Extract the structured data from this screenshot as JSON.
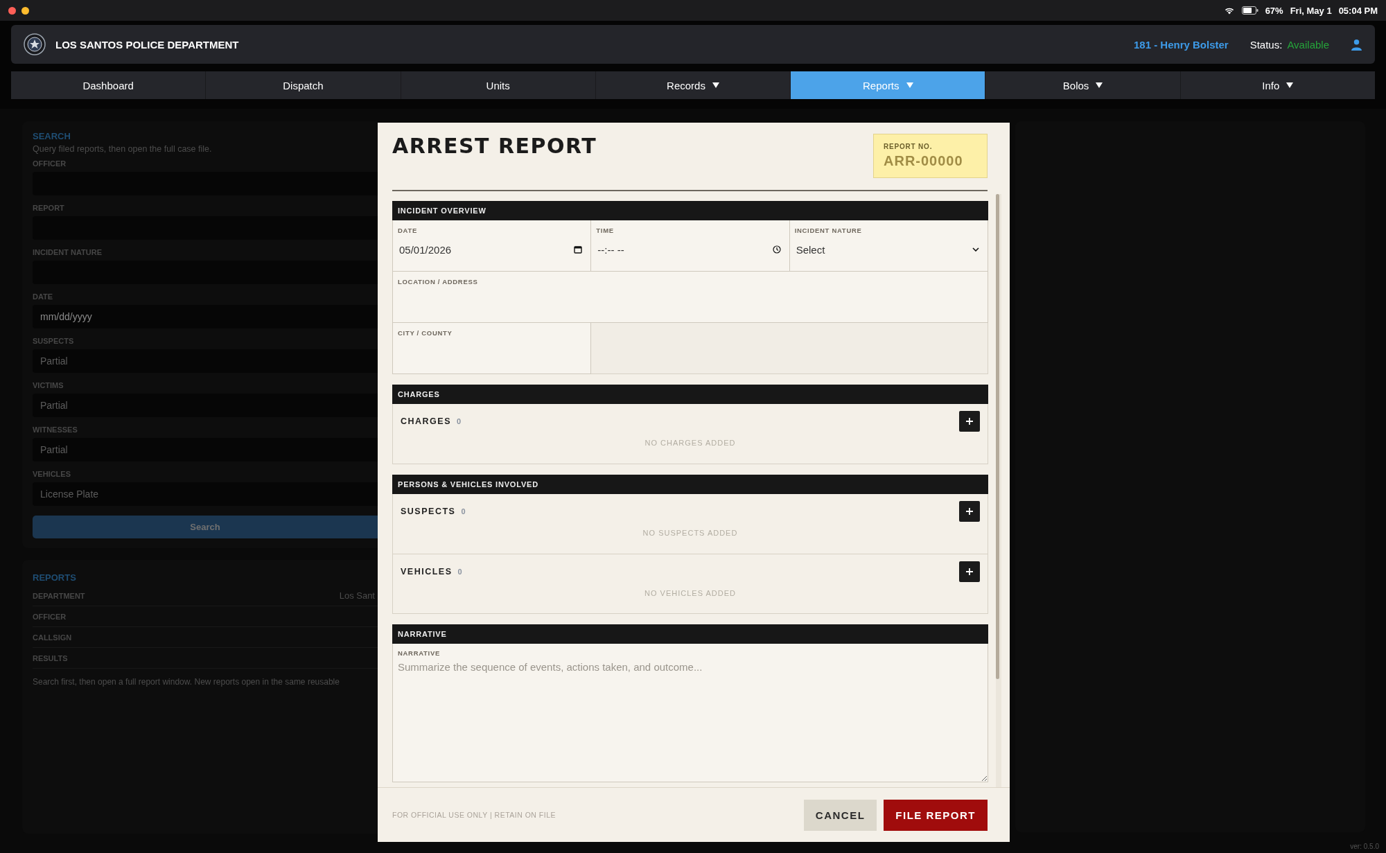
{
  "system_bar": {
    "battery": "67%",
    "date": "Fri, May 1",
    "time": "05:04 PM"
  },
  "header": {
    "title": "LOS SANTOS POLICE DEPARTMENT",
    "user": "181 - Henry Bolster",
    "status_label": "Status:",
    "status": "Available"
  },
  "tabs": [
    {
      "label": "Dashboard",
      "selected": false,
      "dropdown": false
    },
    {
      "label": "Dispatch",
      "selected": false,
      "dropdown": false
    },
    {
      "label": "Units",
      "selected": false,
      "dropdown": false
    },
    {
      "label": "Records",
      "selected": false,
      "dropdown": true
    },
    {
      "label": "Reports",
      "selected": true,
      "dropdown": true
    },
    {
      "label": "Bolos",
      "selected": false,
      "dropdown": true
    },
    {
      "label": "Info",
      "selected": false,
      "dropdown": true
    }
  ],
  "search_panel": {
    "title": "SEARCH",
    "description": "Query filed reports, then open the full case file.",
    "fields": [
      {
        "label": "OFFICER"
      },
      {
        "label": "REPORT"
      },
      {
        "label": "INCIDENT NATURE"
      },
      {
        "label": "DATE",
        "value": "mm/dd/yyyy"
      },
      {
        "label": "SUSPECTS",
        "placeholder": "Partial"
      },
      {
        "label": "VICTIMS",
        "placeholder": "Partial"
      },
      {
        "label": "WITNESSES",
        "placeholder": "Partial"
      },
      {
        "label": "VEHICLES",
        "placeholder": "License Plate"
      }
    ],
    "button": "Search"
  },
  "reports_panel": {
    "title": "REPORTS",
    "rows": [
      {
        "label": "DEPARTMENT",
        "value": "Los Sant"
      },
      {
        "label": "OFFICER"
      },
      {
        "label": "CALLSIGN"
      },
      {
        "label": "RESULTS"
      }
    ],
    "note": "Search first, then open a full report window. New reports open in the same reusable"
  },
  "modal": {
    "title": "ARREST REPORT",
    "report_no_label": "REPORT NO.",
    "report_no": "ARR-00000",
    "sections": [
      {
        "kind": "fields",
        "title": "INCIDENT OVERVIEW",
        "fields": [
          {
            "kind": "date",
            "label": "DATE",
            "value": "05/01/2026"
          },
          {
            "kind": "time",
            "label": "TIME",
            "value": "--:-- --"
          },
          {
            "kind": "select",
            "label": "INCIDENT NATURE",
            "value": "Select"
          },
          {
            "kind": "text",
            "label": "LOCATION / ADDRESS"
          },
          {
            "kind": "text",
            "label": "CITY / COUNTY"
          }
        ]
      },
      {
        "kind": "lists",
        "title": "CHARGES",
        "lists": [
          {
            "label": "CHARGES",
            "count": "0",
            "empty": "NO CHARGES ADDED"
          }
        ]
      },
      {
        "kind": "lists",
        "title": "PERSONS & VEHICLES INVOLVED",
        "lists": [
          {
            "label": "SUSPECTS",
            "count": "0",
            "empty": "NO SUSPECTS ADDED"
          },
          {
            "label": "VEHICLES",
            "count": "0",
            "empty": "NO VEHICLES ADDED"
          }
        ]
      },
      {
        "kind": "textarea",
        "title": "NARRATIVE",
        "label": "NARRATIVE",
        "placeholder": "Summarize the sequence of events, actions taken, and outcome..."
      }
    ],
    "footer_note": "FOR OFFICIAL USE ONLY | RETAIN ON FILE",
    "buttons": [
      {
        "label": "CANCEL",
        "kind": "secondary"
      },
      {
        "label": "FILE REPORT",
        "kind": "primary"
      }
    ]
  },
  "version": "ver: 0.5.0"
}
